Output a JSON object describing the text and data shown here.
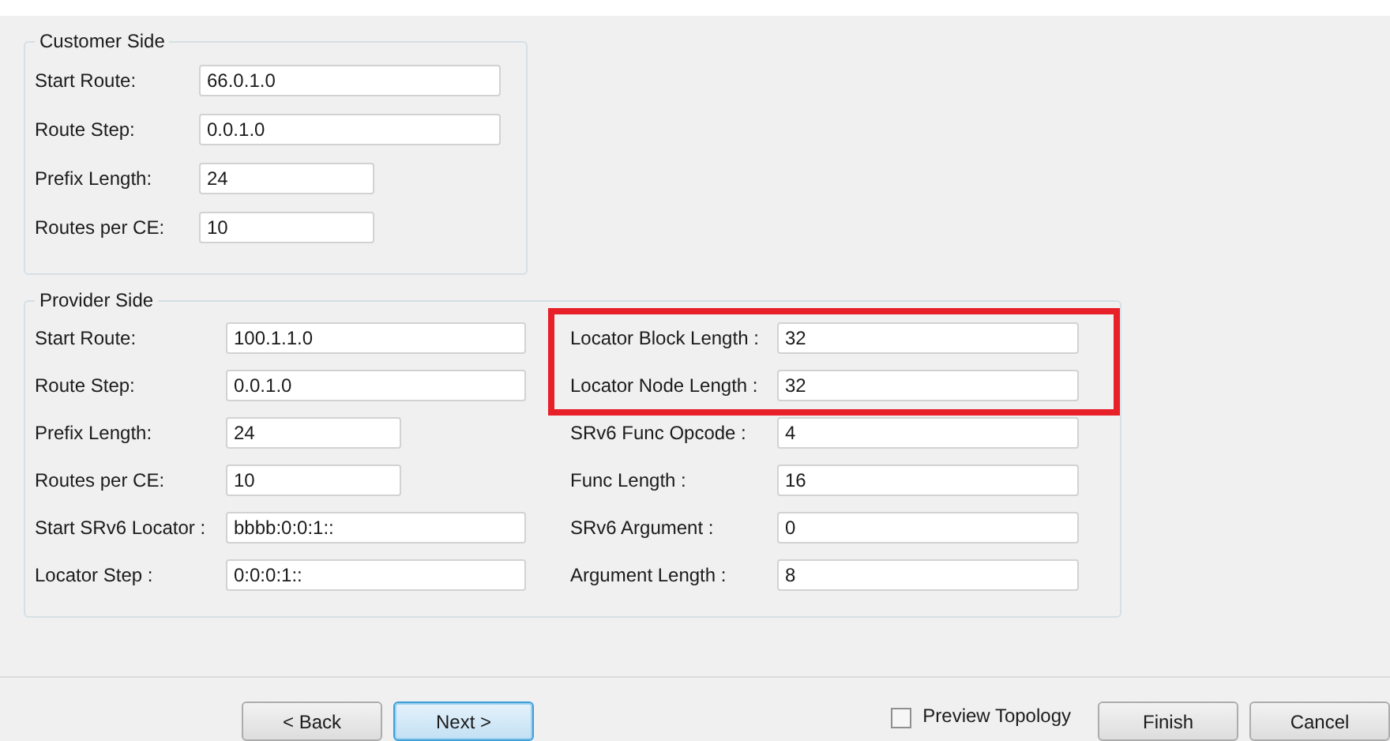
{
  "customer_side": {
    "title": "Customer Side",
    "fields": [
      {
        "label": "Start Route:",
        "value": "66.0.1.0",
        "kind": "address"
      },
      {
        "label": "Route Step:",
        "value": "0.0.1.0",
        "kind": "address"
      },
      {
        "label": "Prefix Length:",
        "value": "24",
        "kind": "number"
      },
      {
        "label": "Routes per CE:",
        "value": "10",
        "kind": "number"
      }
    ]
  },
  "provider_side": {
    "title": "Provider Side",
    "left_fields": [
      {
        "label": "Start Route:",
        "value": "100.1.1.0",
        "kind": "address"
      },
      {
        "label": "Route Step:",
        "value": "0.0.1.0",
        "kind": "address"
      },
      {
        "label": "Prefix Length:",
        "value": "24",
        "kind": "number"
      },
      {
        "label": "Routes per CE:",
        "value": "10",
        "kind": "number"
      },
      {
        "label": "Start SRv6 Locator :",
        "value": "bbbb:0:0:1::",
        "kind": "address"
      },
      {
        "label": "Locator Step :",
        "value": "0:0:0:1::",
        "kind": "address"
      }
    ],
    "right_fields": [
      {
        "label": "Locator Block Length :",
        "value": "32",
        "highlighted": true
      },
      {
        "label": "Locator Node Length :",
        "value": "32",
        "highlighted": true
      },
      {
        "label": "SRv6 Func Opcode :",
        "value": "4",
        "highlighted": false
      },
      {
        "label": "Func Length :",
        "value": "16",
        "highlighted": false
      },
      {
        "label": "SRv6 Argument :",
        "value": "0",
        "highlighted": false
      },
      {
        "label": "Argument Length :",
        "value": "8",
        "highlighted": false
      }
    ]
  },
  "buttons": [
    {
      "label": "< Back",
      "default": false
    },
    {
      "label": "Next >",
      "default": true
    }
  ],
  "preview_topology": {
    "label": "Preview Topology",
    "checked": false
  },
  "end_buttons": [
    {
      "label": "Finish",
      "default": false
    },
    {
      "label": "Cancel",
      "default": false
    }
  ]
}
